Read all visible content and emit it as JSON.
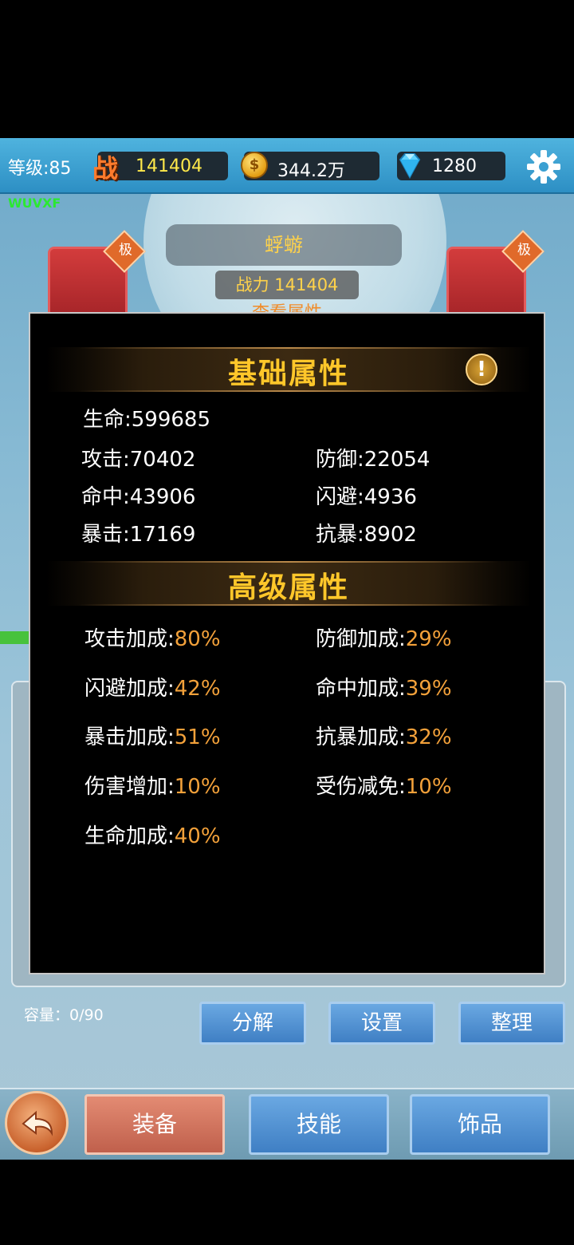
{
  "topbar": {
    "level": "等级:85",
    "power_icon_glyph": "战",
    "power": "141404",
    "gold": "344.2万",
    "diamonds": "1280"
  },
  "player_code": "WUVXF",
  "character": {
    "name": "蜉蝣",
    "power_label": "战力 141404",
    "view_attributes": "查看属性",
    "slot_grade": "极"
  },
  "inventory": {
    "capacity": "容量：0/90",
    "buttons": [
      "分解",
      "设置",
      "整理"
    ]
  },
  "bottom_tabs": [
    "装备",
    "技能",
    "饰品"
  ],
  "dialog": {
    "basic_title": "基础属性",
    "info_icon": "!",
    "basic": {
      "hp": "生命:599685",
      "atk": "攻击:70402",
      "def": "防御:22054",
      "hit": "命中:43906",
      "dodge": "闪避:4936",
      "crit": "暴击:17169",
      "anticrit": "抗暴:8902"
    },
    "advanced_title": "高级属性",
    "advanced": [
      {
        "label": "攻击加成:",
        "value": "80%"
      },
      {
        "label": "防御加成:",
        "value": "29%"
      },
      {
        "label": "闪避加成:",
        "value": "42%"
      },
      {
        "label": "命中加成:",
        "value": "39%"
      },
      {
        "label": "暴击加成:",
        "value": "51%"
      },
      {
        "label": "抗暴加成:",
        "value": "32%"
      },
      {
        "label": "伤害增加:",
        "value": "10%"
      },
      {
        "label": "受伤减免:",
        "value": "10%"
      },
      {
        "label": "生命加成:",
        "value": "40%"
      }
    ]
  },
  "colors": {
    "accent_gold": "#ffc72a",
    "value_orange": "#f3a13a",
    "topbar_blue": "#3aa0d2"
  }
}
